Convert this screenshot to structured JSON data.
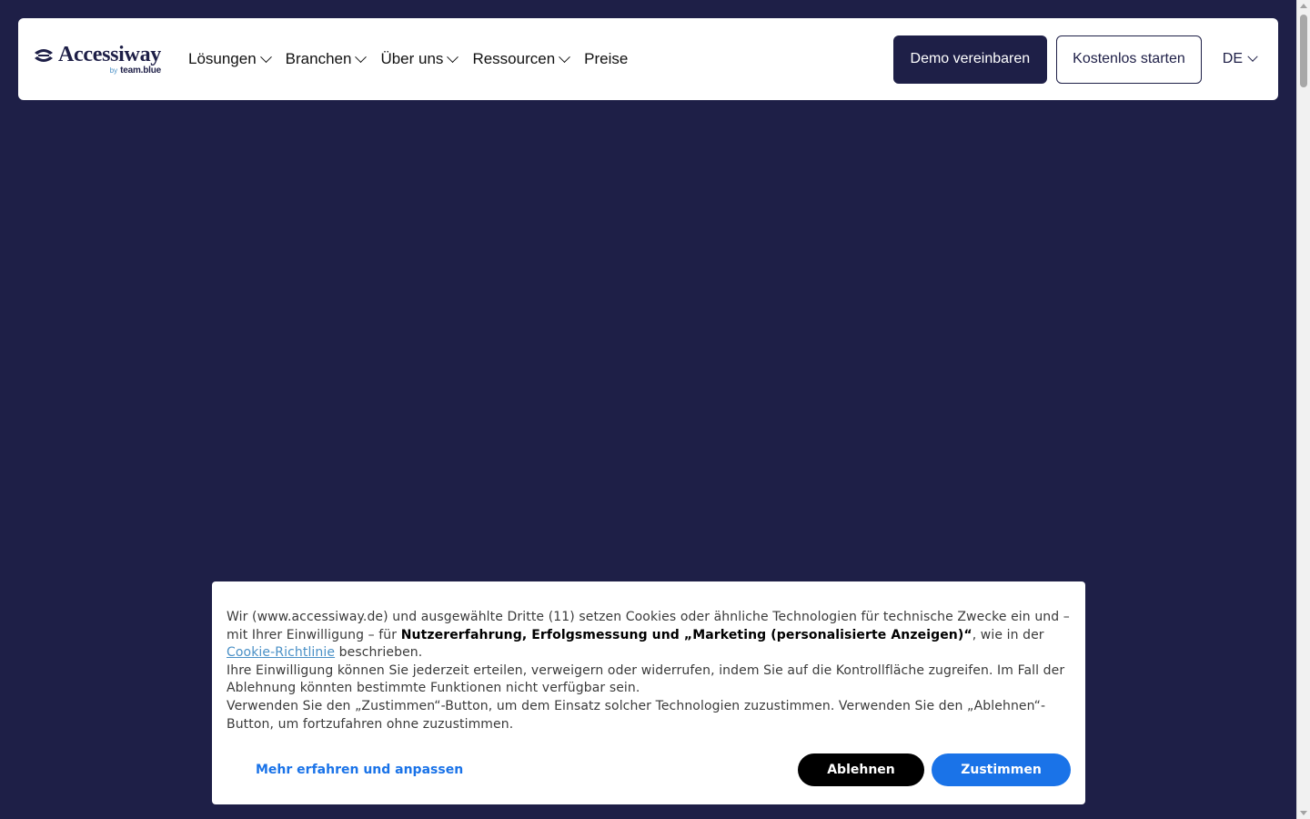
{
  "header": {
    "logo": {
      "name": "Accessiway",
      "by": "by",
      "sub": "team.blue"
    },
    "nav": [
      {
        "label": "Lösungen",
        "dropdown": true
      },
      {
        "label": "Branchen",
        "dropdown": true
      },
      {
        "label": "Über uns",
        "dropdown": true
      },
      {
        "label": "Ressourcen",
        "dropdown": true
      },
      {
        "label": "Preise",
        "dropdown": false
      }
    ],
    "demo_button": "Demo vereinbaren",
    "start_button": "Kostenlos starten",
    "language": "DE"
  },
  "cookie_banner": {
    "p1_before_bold": "Wir (www.accessiway.de) und ausgewählte Dritte (11) setzen Cookies oder ähnliche Technologien für technische Zwecke ein und – mit Ihrer Einwilligung – für ",
    "p1_bold": "Nutzererfahrung, Erfolgsmessung und „Marketing (personalisierte Anzeigen)“",
    "p1_after_bold": ", wie in der ",
    "p1_link": "Cookie-Richtlinie",
    "p1_end": " beschrieben.",
    "p2": "Ihre Einwilligung können Sie jederzeit erteilen, verweigern oder widerrufen, indem Sie auf die Kontrollfläche zugreifen. Im Fall der Ablehnung könnten bestimmte Funktionen nicht verfügbar sein.",
    "p3": "Verwenden Sie den „Zustimmen“-Button, um dem Einsatz solcher Technologien zuzustimmen. Verwenden Sie den „Ablehnen“-Button, um fortzufahren ohne zuzustimmen.",
    "more_button": "Mehr erfahren und anpassen",
    "reject_button": "Ablehnen",
    "accept_button": "Zustimmen"
  },
  "colors": {
    "page_background": "#1e1f47",
    "brand_navy": "#1e1f47",
    "accept_blue": "#1a73e8",
    "link_blue": "#4a90c6"
  }
}
